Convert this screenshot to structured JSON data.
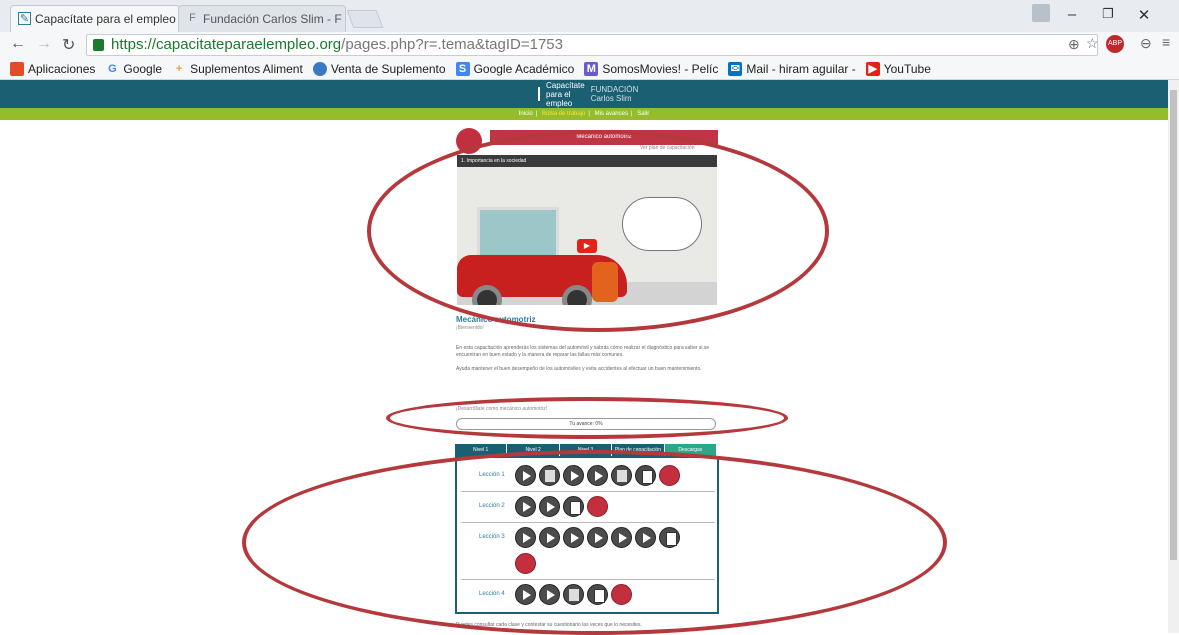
{
  "browser": {
    "tabs": [
      {
        "title": "Capacítate para el empleo",
        "close": "×"
      },
      {
        "title": "Fundación Carlos Slim - F",
        "close": "×"
      }
    ],
    "url_host": "https://capacitateparaelempleo.org",
    "url_path": "/pages.php?r=.tema&tagID=1753",
    "bookmarks": [
      {
        "label": "Aplicaciones",
        "icon": "apps-icon",
        "color": "#e34c26"
      },
      {
        "label": "Google",
        "icon": "google-icon",
        "color": "#4285f4"
      },
      {
        "label": "Suplementos Aliment",
        "icon": "plus-icon",
        "color": "#e8a33d"
      },
      {
        "label": "Venta de Suplemento",
        "icon": "globe-icon",
        "color": "#3b78c2"
      },
      {
        "label": "Google Académico",
        "icon": "scholar-icon",
        "color": "#4285f4"
      },
      {
        "label": "SomosMovies! - Pelíc",
        "icon": "movie-icon",
        "color": "#6a5acd"
      },
      {
        "label": "Mail - hiram aguilar -",
        "icon": "mail-icon",
        "color": "#0072c6"
      },
      {
        "label": "YouTube",
        "icon": "youtube-icon",
        "color": "#e62117"
      }
    ]
  },
  "site": {
    "logo": "Capacítate para el empleo",
    "fundacion": "FUNDACIÓN Carlos Slim",
    "nav": [
      "Inicio",
      "Bolsa de trabajo",
      "Mis avances",
      "Salir"
    ],
    "course_title": "Mecánico automotriz",
    "small_link": "Ver plan de capacitación",
    "video_title": "1. Importancia en la sociedad",
    "heading": "Mecánico automotriz",
    "welcome": "¡Bienvenido!",
    "para1": "En esta capacitación aprenderás los sistemas del automóvil y sabrás cómo realizar el diagnóstico para saber si se encuentran en buen estado y la manera de reparar las fallas más comunes.",
    "para2": "Ayuda mantener el buen desempeño de los automóviles y evita accidentes al efectuar un buen mantenimiento.",
    "develop": "¡Desarróllate como mecánico automotriz!",
    "progress": "Tu avance: 0%",
    "course_tabs": [
      "Nivel 1",
      "Nivel 2",
      "Nivel 3",
      "Plan de capacitación",
      "Descargas"
    ],
    "lessons": [
      {
        "label": "Lección 1",
        "icons": [
          "play",
          "doc",
          "play",
          "play",
          "doc",
          "book",
          "red"
        ]
      },
      {
        "label": "Lección 2",
        "icons": [
          "play",
          "play",
          "book",
          "red"
        ]
      },
      {
        "label": "Lección 3",
        "icons": [
          "play",
          "play",
          "play",
          "play",
          "play",
          "play",
          "book",
          "red"
        ]
      },
      {
        "label": "Lección 4",
        "icons": [
          "play",
          "play",
          "doc",
          "book",
          "red"
        ]
      }
    ],
    "bottom_text": "Puedes consultar cada clase y contestar su cuestionario las veces que lo necesites."
  }
}
